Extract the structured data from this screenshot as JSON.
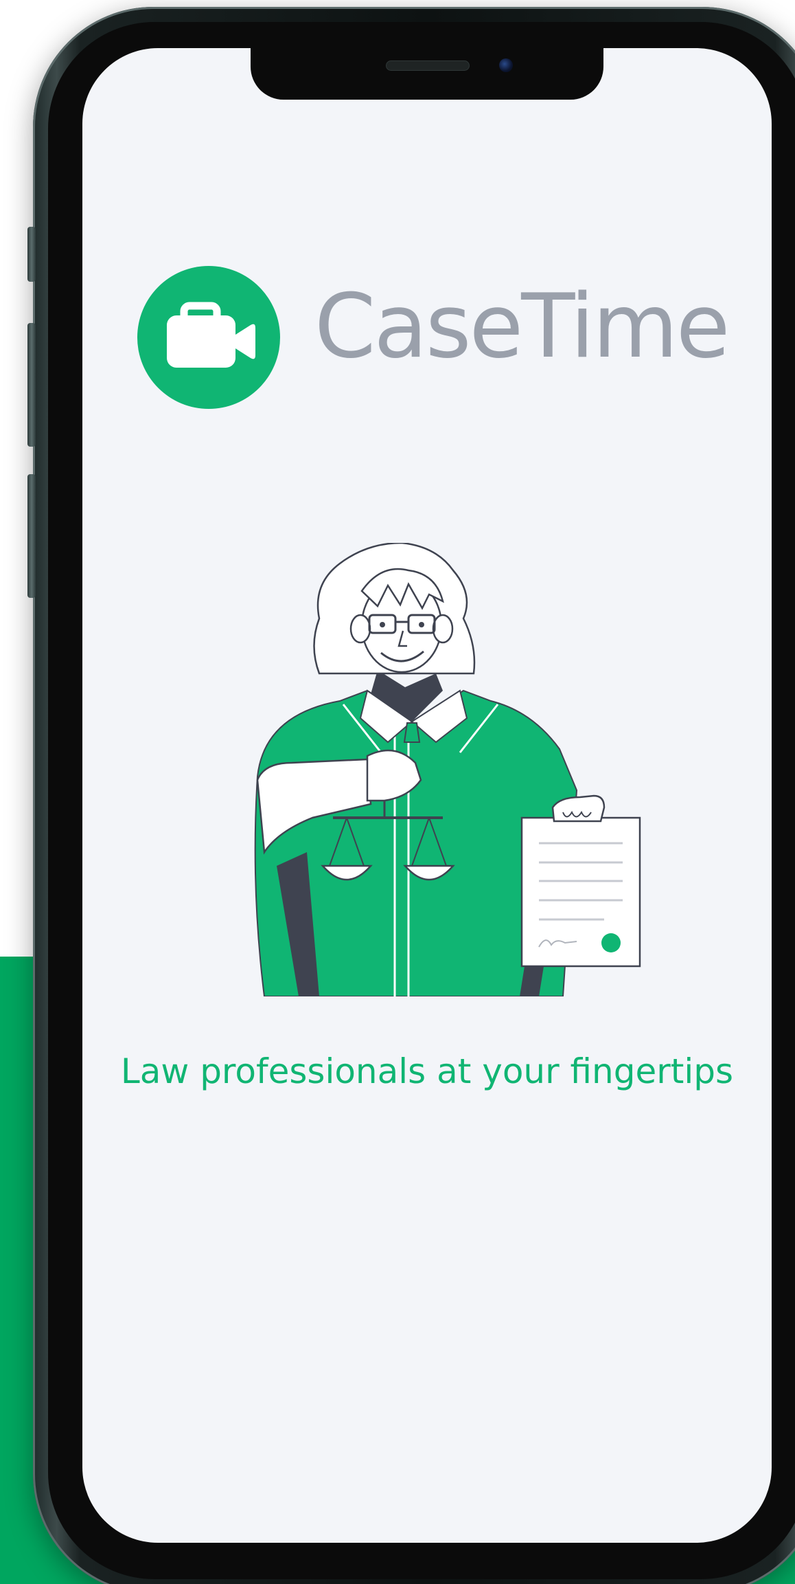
{
  "brand": {
    "name": "CaseTime",
    "logo_icon": "video-camera-icon",
    "logo_color": "#10b573",
    "wordmark_color": "#9aa0ab"
  },
  "splash": {
    "tagline": "Law professionals at your fingertips",
    "illustration": "lawyer-holding-document-illustration"
  },
  "colors": {
    "accent": "#10b573",
    "background": "#f3f5f9",
    "band": "#00a65f",
    "dark": "#3f4350"
  }
}
